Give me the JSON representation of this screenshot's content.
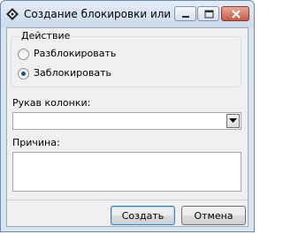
{
  "window": {
    "title": "Создание блокировки или ...",
    "icon": "diamond-app-icon",
    "controls": {
      "minimize_icon": "minimize-icon",
      "maximize_icon": "maximize-icon",
      "close_icon": "close-icon"
    }
  },
  "action_group": {
    "legend": "Действие",
    "options": [
      {
        "label": "Разблокировать",
        "selected": false
      },
      {
        "label": "Заблокировать",
        "selected": true
      }
    ]
  },
  "column_sleeve": {
    "label": "Рукав колонки:",
    "value": ""
  },
  "reason": {
    "label": "Причина:",
    "value": ""
  },
  "buttons": {
    "create": "Создать",
    "cancel": "Отмена"
  },
  "colors": {
    "accent": "#3c7fb1",
    "close_button": "#c75a44",
    "titlebar": "#cbdaeb"
  }
}
